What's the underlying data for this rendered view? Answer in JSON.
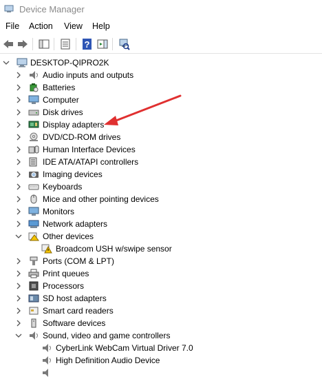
{
  "window": {
    "title": "Device Manager"
  },
  "menu": [
    "File",
    "Action",
    "View",
    "Help"
  ],
  "toolbar": [
    {
      "name": "back-icon"
    },
    {
      "name": "forward-icon"
    },
    {
      "name": "show-hide-console-tree-icon"
    },
    {
      "name": "properties-icon"
    },
    {
      "name": "help-icon"
    },
    {
      "name": "action-pane-icon"
    },
    {
      "name": "scan-hardware-icon"
    }
  ],
  "tree": {
    "root": "DESKTOP-QIPRO2K",
    "categories": [
      {
        "label": "Audio inputs and outputs",
        "expanded": false
      },
      {
        "label": "Batteries",
        "expanded": false
      },
      {
        "label": "Computer",
        "expanded": false
      },
      {
        "label": "Disk drives",
        "expanded": false
      },
      {
        "label": "Display adapters",
        "expanded": false
      },
      {
        "label": "DVD/CD-ROM drives",
        "expanded": false
      },
      {
        "label": "Human Interface Devices",
        "expanded": false
      },
      {
        "label": "IDE ATA/ATAPI controllers",
        "expanded": false
      },
      {
        "label": "Imaging devices",
        "expanded": false
      },
      {
        "label": "Keyboards",
        "expanded": false
      },
      {
        "label": "Mice and other pointing devices",
        "expanded": false
      },
      {
        "label": "Monitors",
        "expanded": false
      },
      {
        "label": "Network adapters",
        "expanded": false
      },
      {
        "label": "Other devices",
        "expanded": true,
        "children": [
          "Broadcom USH w/swipe sensor"
        ]
      },
      {
        "label": "Ports (COM & LPT)",
        "expanded": false
      },
      {
        "label": "Print queues",
        "expanded": false
      },
      {
        "label": "Processors",
        "expanded": false
      },
      {
        "label": "SD host adapters",
        "expanded": false
      },
      {
        "label": "Smart card readers",
        "expanded": false
      },
      {
        "label": "Software devices",
        "expanded": false
      },
      {
        "label": "Sound, video and game controllers",
        "expanded": true,
        "children": [
          "CyberLink WebCam Virtual Driver 7.0",
          "High Definition Audio Device"
        ]
      }
    ]
  },
  "colors": {
    "annotation_arrow": "#e03030",
    "warning": "#f5c400"
  }
}
